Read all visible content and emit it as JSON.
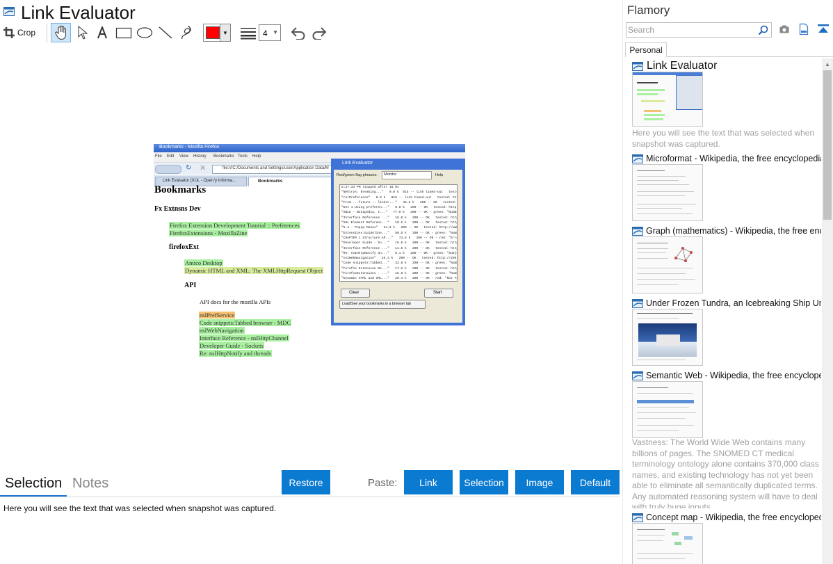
{
  "window": {
    "title": "Link Evaluator"
  },
  "toolbar": {
    "crop_label": "Crop",
    "color_value": "#ff0000",
    "line_width": "4"
  },
  "snapshot": {
    "browser_title": "Bookmarks - Mozilla Firefox",
    "menu": [
      "File",
      "Edit",
      "View",
      "History",
      "Bookmarks",
      "Tools",
      "Help"
    ],
    "address": "file:///C:/Documents and Settings/user/Application Data/M",
    "tabs": [
      "Link Evaluator (XUL - Oper√y Informa...",
      "Bookmarks"
    ],
    "heading": "Bookmarks",
    "groups": {
      "fx": "Fx Extnsns Dev",
      "firefoxext": "firefoxExt",
      "api": "API",
      "api_desc": "API docs for the mozilla APIs"
    },
    "links": [
      "Firefox Extension Development Tutorial :: Preferences",
      "FirefoxExtensions - MozillaZine",
      "Amico Desktop",
      "Dynamic HTML and XML: The XMLHttpRequest Object",
      "nsIPrefService",
      "Code snippets:Tabbed browser - MDC",
      "nsIWebNavigation",
      "Interface Reference - nsIHttpChannel",
      "Developer Guide - Sockets",
      "Re: nsIHttpNotify and threads"
    ],
    "dialog": {
      "title": "Link Evaluator",
      "field_label": "Red/green flag phrases:",
      "field_value": "Monitor",
      "help": "Help",
      "log": [
        "5:27:33 PM stopped after 18.0s",
        "\"Nektrys: Breaking...\"   0.0 k  915 -- link timed-out   tested:",
        "\"relPreference\"   0.0 k   915 -- link timed-out   tested: https:/",
        "\"From ...future... linker...\"   46.5 k   200 -- OK   tested: http",
        "\"Dev 1 Using preferen...\"   8.0 k   200 -- OK   tested: http://l",
        "\"XBLE - Wikipedia, t...\"   77.0 k   200 -- OK - green: \"Number\"",
        "\"Interface Reference ...\"   18.0 k   200 -- OK   tested: http",
        "\"XUL Element Referenc...\"   10.2 k   200 -- OK   tested: http",
        "\"5.4 - Popup Menus\"   24.0 k   200 -- OK   tested: http://www",
        "\"Extensions:Guideline...\"   50.5 k   200 -- OK - green: \"Numbe\"",
        "\"CHAPTER 1 Structure AP...\"   73.6 k   200 -- OK - red: \"Error - up",
        "\"Developer Guide - So...\"   16.8 k   200 -- OK   tested: http://",
        "\"Interface Reference ...\"   14.5 k   200 -- OK   tested: http://",
        "\"Re: nsIHttpNotify an...\"   8.1 k   200 -- OK - green: \"Subject\"",
        "\"nsIWebNavigation\"   25.3 k   200 -- OK   tested: http://205.",
        "\"Code snippets:Tabbed...\"   33.8 k   200 -- OK - green: \"Number\"",
        "\"Firefox Extension De...\"   17.2 k   200 -- OK   tested: http://",
        "\"FirefoxExtensions - ...\"   15.8 k   200 -- OK - green: \"Number\"",
        "\"Dynamic HTML and XML...\"   20.4 k   200 -- OK - red: \"Not Foun",
        "\"Amico Desktop\"   5.4 k   200 -- OK   tested: http://www.sun"
      ],
      "clear": "Clear",
      "start": "Start",
      "load_btn": "Load/See your bookmarks in a browser tab"
    }
  },
  "bottom": {
    "tabs": [
      "Selection",
      "Notes"
    ],
    "restore": "Restore",
    "paste_label": "Paste:",
    "paste_buttons": [
      "Link",
      "Selection",
      "Image",
      "Default"
    ],
    "selection_text": "Here you will see the text that was selected when snapshot was captured."
  },
  "flamory": {
    "title": "Flamory",
    "search_placeholder": "Search",
    "tab": "Personal",
    "items": [
      {
        "title": "Link Evaluator",
        "desc": "Here you will see the text that was selected when snapshot was captured."
      },
      {
        "title": "Microformat - Wikipedia, the free encyclopedia"
      },
      {
        "title": "Graph (mathematics) - Wikipedia, the free ency"
      },
      {
        "title": "Under Frozen Tundra, an Icebreaking Ship Unco"
      },
      {
        "title": "Semantic Web - Wikipedia, the free encycloped",
        "desc": "Vastness: The World Wide Web contains many billions of pages. The SNOMED CT medical terminology ontology alone contains 370,000 class names, and existing technology has not yet been able to eliminate all semantically duplicated terms. Any automated reasoning system will have to deal with truly huge inputs."
      },
      {
        "title": "Concept map - Wikipedia, the free encyclopedi"
      }
    ]
  },
  "colors": {
    "accent": "#0b7ad1",
    "highlight_green": "#a8f0a0",
    "highlight_yellow": "#d8ec9c",
    "highlight_orange": "#f5c070",
    "pen_color": "#ff0000"
  }
}
